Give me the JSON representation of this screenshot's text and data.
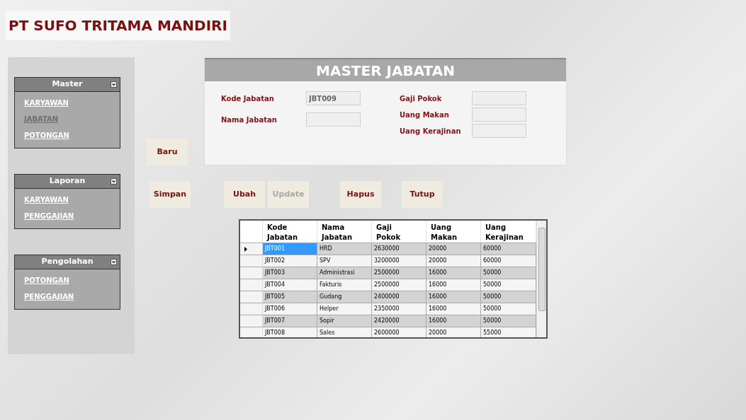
{
  "app_title": "PT SUFO TRITAMA MANDIRI",
  "sidebar": {
    "groups": [
      {
        "title": "Master",
        "items": [
          {
            "label": "KARYAWAN",
            "disabled": false
          },
          {
            "label": "JABATAN",
            "disabled": true
          },
          {
            "label": "POTONGAN",
            "disabled": false
          }
        ]
      },
      {
        "title": "Laporan",
        "items": [
          {
            "label": "KARYAWAN",
            "disabled": false
          },
          {
            "label": "PENGGAJIAN",
            "disabled": false
          }
        ]
      },
      {
        "title": "Pengolahan",
        "items": [
          {
            "label": "POTONGAN",
            "disabled": false
          },
          {
            "label": "PENGGAJIAN",
            "disabled": false
          }
        ]
      }
    ]
  },
  "form": {
    "title": "MASTER JABATAN",
    "left_fields": [
      {
        "label": "Kode Jabatan",
        "value": "JBT009"
      },
      {
        "label": "Nama Jabatan"
      }
    ],
    "right_fields": [
      {
        "label": "Gaji Pokok"
      },
      {
        "label": "Uang Makan"
      },
      {
        "label": "Uang Kerajinan"
      }
    ]
  },
  "new_button": {
    "label": "Baru",
    "disabled": false
  },
  "action_buttons": [
    {
      "label": "Simpan",
      "disabled": false
    },
    {
      "label": "Ubah",
      "disabled": false
    },
    {
      "label": "Update",
      "disabled": true
    },
    {
      "label": "Hapus",
      "disabled": false
    },
    {
      "label": "Tutup",
      "disabled": false
    }
  ],
  "table": {
    "columns": [
      "Kode Jabatan",
      "Nama Jabatan",
      "Gaji Pokok",
      "Uang Makan",
      "Uang Kerajinan"
    ],
    "rows": [
      {
        "cells": [
          "JBT001",
          "HRD",
          "2630000",
          "20000",
          "60000"
        ],
        "selected": true
      },
      {
        "cells": [
          "JBT002",
          "SPV",
          "3200000",
          "20000",
          "60000"
        ],
        "selected": false
      },
      {
        "cells": [
          "JBT003",
          "Administrasi",
          "2500000",
          "16000",
          "50000"
        ],
        "selected": false
      },
      {
        "cells": [
          "JBT004",
          "Fakturis",
          "2500000",
          "16000",
          "50000"
        ],
        "selected": false
      },
      {
        "cells": [
          "JBT005",
          "Gudang",
          "2400000",
          "16000",
          "50000"
        ],
        "selected": false
      },
      {
        "cells": [
          "JBT006",
          "Helper",
          "2350000",
          "16000",
          "50000"
        ],
        "selected": false
      },
      {
        "cells": [
          "JBT007",
          "Sopir",
          "2420000",
          "16000",
          "50000"
        ],
        "selected": false
      },
      {
        "cells": [
          "JBT008",
          "Sales",
          "2600000",
          "20000",
          "55000"
        ],
        "selected": false
      }
    ]
  }
}
